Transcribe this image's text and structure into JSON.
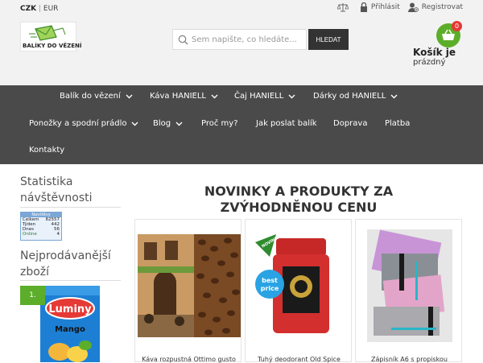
{
  "header": {
    "currency_active": "CZK",
    "currency_sep": "|",
    "currency_other": "EUR",
    "login_label": "Přihlásit",
    "register_label": "Registrovat",
    "logo_text": "BALÍKY DO VĚZENÍ",
    "search_placeholder": "Sem napište, co hledáte...",
    "search_button": "HLEDAT",
    "cart_count": "0",
    "cart_title": "Košík je",
    "cart_status": "prázdný"
  },
  "nav": {
    "items": [
      {
        "label": "Balík do vězení"
      },
      {
        "label": "Káva HANIELL"
      },
      {
        "label": "Čaj HANIELL"
      },
      {
        "label": "Dárky od HANIELL"
      },
      {
        "label": "Ponožky a spodní prádlo"
      },
      {
        "label": "Blog"
      },
      {
        "label": "Proč my?"
      },
      {
        "label": "Jak poslat balík"
      },
      {
        "label": "Doprava"
      },
      {
        "label": "Platba"
      },
      {
        "label": "Kontakty"
      }
    ]
  },
  "sidebar": {
    "stats_title_1": "Statistika",
    "stats_title_2": "návštěvnosti",
    "counter": {
      "header": "Navštěvy",
      "rows": [
        {
          "label": "Celkem",
          "value": "82557"
        },
        {
          "label": "Týden",
          "value": "442"
        },
        {
          "label": "Dnes",
          "value": "56"
        },
        {
          "label": "Online",
          "value": "4"
        }
      ]
    },
    "best_title_1": "Nejprodávanější",
    "best_title_2": "zboží",
    "rank": "1.",
    "best_brand": "Luminy",
    "best_flavor": "Mango"
  },
  "main": {
    "title_1": "NOVINKY A PRODUKTY ZA",
    "title_2": "ZVÝHODNĚNOU CENU",
    "products": [
      {
        "name": "Káva rozpustná Ottimo gusto"
      },
      {
        "name": "Tuhý deodorant Old Spice"
      },
      {
        "name": "Zápisník A6 s propiskou"
      }
    ],
    "badge_new": "NOVINKA",
    "badge_price_1": "best",
    "badge_price_2": "price"
  }
}
